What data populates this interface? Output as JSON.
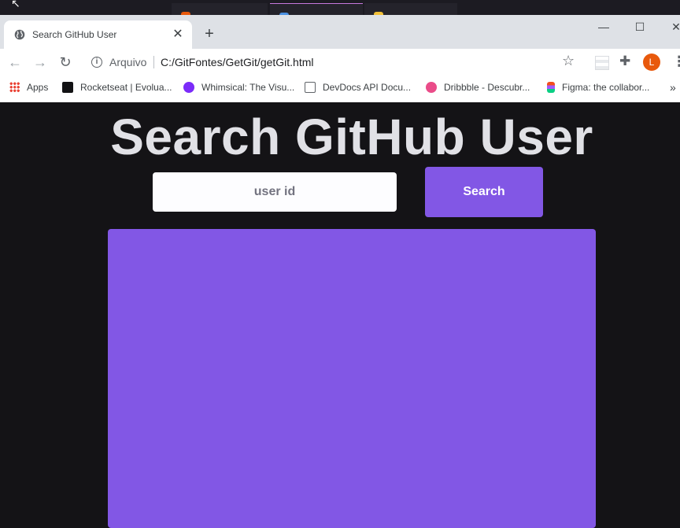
{
  "browser": {
    "tab_title": "Search GitHub User",
    "tab_close": "✕",
    "new_tab": "+",
    "window_controls": {
      "minimize": "—",
      "maximize": "☐",
      "close": "✕"
    },
    "nav": {
      "back": "←",
      "forward": "→",
      "reload": "↻"
    },
    "address": {
      "scheme_label": "Arquivo",
      "url": "C:/GitFontes/GetGit/getGit.html"
    },
    "star": "☆",
    "extensions": "✚",
    "avatar_letter": "L",
    "menu": "⋮",
    "bookmarks": [
      {
        "label": "Apps",
        "icon": "apps-grid-icon",
        "color": "#ea4335"
      },
      {
        "label": "Rocketseat | Evolua...",
        "icon": "rocketseat-icon",
        "color": "#121214"
      },
      {
        "label": "Whimsical: The Visu...",
        "icon": "whimsical-icon",
        "color": "#7b2bf9"
      },
      {
        "label": "DevDocs API Docu...",
        "icon": "devdocs-icon",
        "color": "#5f6368"
      },
      {
        "label": "Dribbble - Descubr...",
        "icon": "dribbble-icon",
        "color": "#ea4c89"
      },
      {
        "label": "Figma: the collabor...",
        "icon": "figma-icon",
        "color": "#f24e1e"
      }
    ],
    "bookmarks_more": "»"
  },
  "page": {
    "title": "Search GitHub User",
    "search": {
      "placeholder": "user id",
      "value": ""
    },
    "search_button": "Search",
    "colors": {
      "background": "#141316",
      "accent": "#8257e5",
      "title": "#e1e1e6"
    }
  }
}
